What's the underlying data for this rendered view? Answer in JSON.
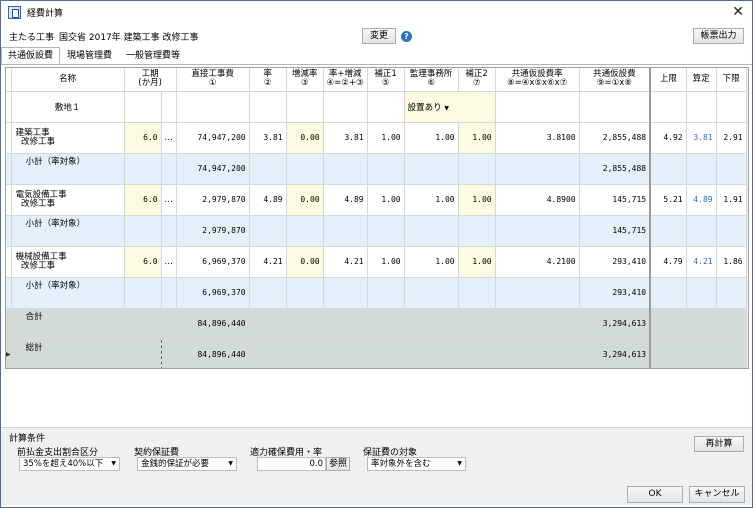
{
  "window": {
    "title": "経費計算",
    "close": "✕"
  },
  "project": {
    "label": "主たる工事",
    "value": "国交省 2017年 建築工事 改修工事"
  },
  "buttons": {
    "change": "変更",
    "report": "帳票出力",
    "recalc": "再計算",
    "ok": "OK",
    "cancel": "キャンセル",
    "ref": "参照"
  },
  "tabs": [
    "共通仮設費",
    "現場管理費",
    "一般管理費等"
  ],
  "columns": {
    "name": "名称",
    "period": [
      "工期",
      "(か月)"
    ],
    "direct": [
      "直接工事費",
      "①"
    ],
    "rate": [
      "率",
      "②"
    ],
    "incdec_rate": [
      "増減率",
      "③"
    ],
    "rate_incdec": [
      "率+増減",
      "④=②+③"
    ],
    "adj1": [
      "補正1",
      "⑤"
    ],
    "supervisor": [
      "監理事務所",
      "⑥"
    ],
    "adj2": [
      "補正2",
      "⑦"
    ],
    "common_rate": [
      "共通仮設費率",
      "⑧=④x⑤x⑥x⑦"
    ],
    "common_cost": [
      "共通仮設費",
      "⑨=①x⑧"
    ],
    "upper": "上限",
    "calc": "算定",
    "lower": "下限"
  },
  "rows": [
    {
      "type": "site",
      "name": "敷地１",
      "supervisor": "設置あり"
    },
    {
      "type": "work",
      "name1": "建築工事",
      "name2": "改修工事",
      "period": "6.0",
      "dots": "…",
      "direct": "74,947,200",
      "rate": "3.81",
      "incdec": "0.00",
      "rate_incdec": "3.81",
      "adj1": "1.00",
      "supervisor": "1.00",
      "adj2": "1.00",
      "common_rate": "3.8100",
      "common_cost": "2,855,488",
      "upper": "4.92",
      "calc": "3.81",
      "lower": "2.91"
    },
    {
      "type": "subtotal",
      "name": "小計（率対象）",
      "direct": "74,947,200",
      "common_cost": "2,855,488"
    },
    {
      "type": "work",
      "name1": "電気設備工事",
      "name2": "改修工事",
      "period": "6.0",
      "dots": "…",
      "direct": "2,979,870",
      "rate": "4.89",
      "incdec": "0.00",
      "rate_incdec": "4.89",
      "adj1": "1.00",
      "supervisor": "1.00",
      "adj2": "1.00",
      "common_rate": "4.8900",
      "common_cost": "145,715",
      "upper": "5.21",
      "calc": "4.89",
      "lower": "1.91"
    },
    {
      "type": "subtotal",
      "name": "小計（率対象）",
      "direct": "2,979,870",
      "common_cost": "145,715"
    },
    {
      "type": "work",
      "name1": "機械設備工事",
      "name2": "改修工事",
      "period": "6.0",
      "dots": "…",
      "direct": "6,969,370",
      "rate": "4.21",
      "incdec": "0.00",
      "rate_incdec": "4.21",
      "adj1": "1.00",
      "supervisor": "1.00",
      "adj2": "1.00",
      "common_rate": "4.2100",
      "common_cost": "293,410",
      "upper": "4.79",
      "calc": "4.21",
      "lower": "1.86"
    },
    {
      "type": "subtotal",
      "name": "小計（率対象）",
      "direct": "6,969,370",
      "common_cost": "293,410"
    },
    {
      "type": "total",
      "name": "合計",
      "direct": "84,896,440",
      "common_cost": "3,294,613"
    },
    {
      "type": "grand",
      "name": "総計",
      "direct": "84,896,440",
      "common_cost": "3,294,613"
    }
  ],
  "conditions": {
    "title": "計算条件",
    "advance_label": "前払金支出割合区分",
    "advance_value": "35%を超え40%以下",
    "contract_label": "契約保証費",
    "contract_value": "金銭的保証が必要",
    "capacity_label": "適力確保費用・率",
    "capacity_value": "0.0",
    "guarantee_label": "保証費の対象",
    "guarantee_value": "率対象外を含む"
  },
  "colors": {
    "accent": "#2b72c2",
    "yellow_cell": "#fbfbe1",
    "subtotal_row": "#e4f0fa",
    "total_row": "#d3dada",
    "calc_text": "#3468c8"
  }
}
